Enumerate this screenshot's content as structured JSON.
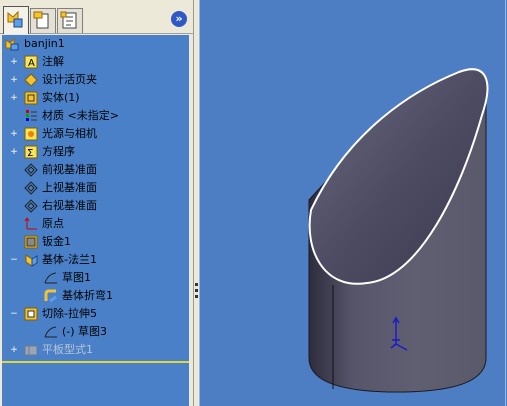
{
  "tree": {
    "root": "banjin1",
    "items": [
      {
        "label": "注解",
        "expander": "+",
        "icon": "annotations-icon"
      },
      {
        "label": "设计活页夹",
        "expander": "+",
        "icon": "design-binder-icon"
      },
      {
        "label": "实体(1)",
        "expander": "+",
        "icon": "solid-bodies-icon"
      },
      {
        "label": "材质 <未指定>",
        "expander": "",
        "icon": "material-icon"
      },
      {
        "label": "光源与相机",
        "expander": "+",
        "icon": "lights-cameras-icon"
      },
      {
        "label": "方程序",
        "expander": "+",
        "icon": "equations-icon"
      },
      {
        "label": "前视基准面",
        "expander": "",
        "icon": "front-plane-icon"
      },
      {
        "label": "上视基准面",
        "expander": "",
        "icon": "top-plane-icon"
      },
      {
        "label": "右视基准面",
        "expander": "",
        "icon": "right-plane-icon"
      },
      {
        "label": "原点",
        "expander": "",
        "icon": "origin-icon"
      },
      {
        "label": "钣金1",
        "expander": "",
        "icon": "sheet-metal-icon"
      },
      {
        "label": "基体-法兰1",
        "expander": "−",
        "icon": "base-flange-icon"
      },
      {
        "label": "草图1",
        "expander": "",
        "icon": "sketch-icon"
      },
      {
        "label": "基体折弯1",
        "expander": "",
        "icon": "base-bend-icon"
      },
      {
        "label": "切除-拉伸5",
        "expander": "−",
        "icon": "cut-extrude-icon"
      },
      {
        "label": "(-) 草图3",
        "expander": "",
        "icon": "sketch-icon"
      },
      {
        "label": "平板型式1",
        "expander": "+",
        "icon": "flat-pattern-icon"
      }
    ]
  },
  "collapse_glyph": "»",
  "colors": {
    "tree_bg": "#4a80c8",
    "viewport_bg": "#4d7dc3",
    "rollback_bar": "#e0d640"
  }
}
